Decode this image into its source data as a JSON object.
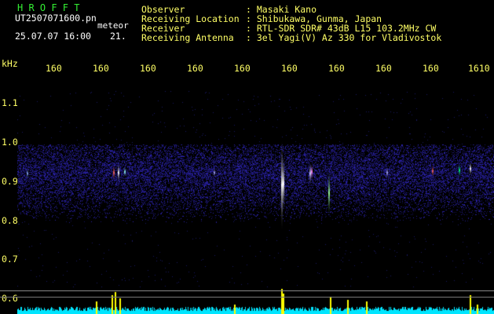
{
  "header": {
    "logo": "H R O F F T",
    "filename": "UT2507071600.pn",
    "suffix": "meteor",
    "datetime": "25.07.07 16:00",
    "count": "21.",
    "fields": [
      {
        "label": "Observer",
        "value": ": Masaki Kano"
      },
      {
        "label": "Receiving Location",
        "value": ": Shibukawa, Gunma, Japan"
      },
      {
        "label": "Receiver",
        "value": ": RTL-SDR SDR# 43dB L15 103.2MHz CW"
      },
      {
        "label": "Receiving Antenna",
        "value": ": 3el Yagi(V) Az 330 for Vladivostok"
      }
    ]
  },
  "axes": {
    "unit": "kHz",
    "time_ticks": [
      "160",
      "160",
      "160",
      "160",
      "160",
      "160",
      "160",
      "160",
      "160",
      "1610"
    ],
    "freq_ticks": [
      "1.1",
      "1.0",
      "0.9",
      "0.8",
      "0.7",
      "0.6"
    ]
  },
  "colors": {
    "background": "#000000",
    "text": "#ffff66",
    "logo": "#33ee33",
    "noise": "#1a1aa0",
    "meteor": "#ffffff",
    "trace": "#00e5ff",
    "trace_peak": "#ffff00"
  }
}
